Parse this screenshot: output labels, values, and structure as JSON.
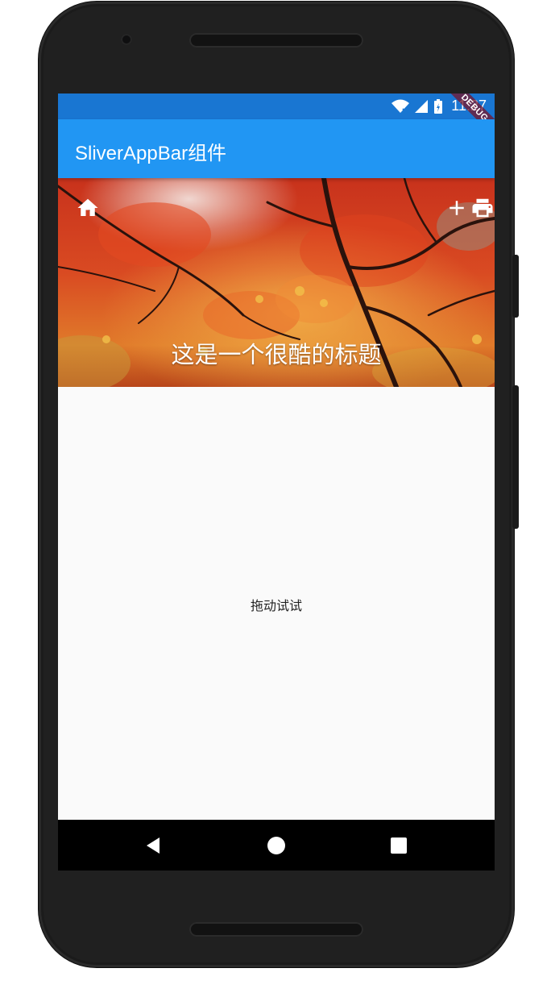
{
  "status_bar": {
    "time": "11:27",
    "debug_label": "DEBUG",
    "color": "#1976d2"
  },
  "app_bar": {
    "title": "SliverAppBar组件",
    "color": "#2196f3"
  },
  "sliver_app_bar": {
    "title": "这是一个很酷的标题",
    "leading_icon": "home-icon",
    "actions": [
      "add-icon",
      "print-icon"
    ]
  },
  "body": {
    "text": "拖动试试",
    "background": "#fafafa"
  },
  "nav_bar": {
    "buttons": [
      "back-icon",
      "home-circle-icon",
      "recents-square-icon"
    ]
  }
}
